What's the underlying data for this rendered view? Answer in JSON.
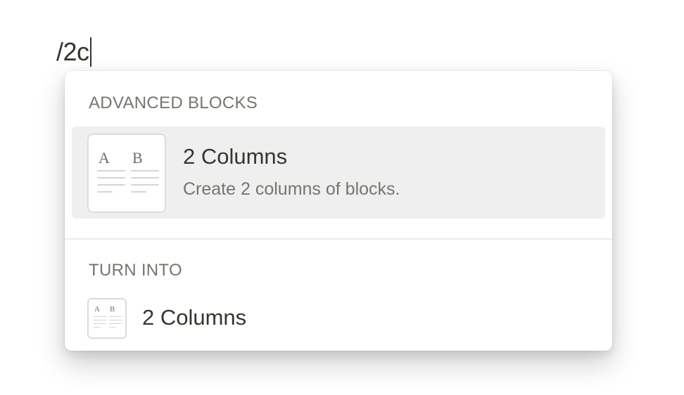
{
  "editor": {
    "typed_text": "/2c"
  },
  "menu": {
    "sections": [
      {
        "header": "ADVANCED BLOCKS",
        "item": {
          "title": "2 Columns",
          "description": "Create 2 columns of blocks.",
          "icon": "two-columns-icon",
          "thumb_letter_a": "A",
          "thumb_letter_b": "B"
        }
      },
      {
        "header": "TURN INTO",
        "item": {
          "title": "2 Columns",
          "icon": "two-columns-icon",
          "thumb_letter_a": "A",
          "thumb_letter_b": "B"
        }
      }
    ]
  },
  "colors": {
    "text": "#37352f",
    "muted": "#76756f",
    "highlight": "#efefef"
  }
}
